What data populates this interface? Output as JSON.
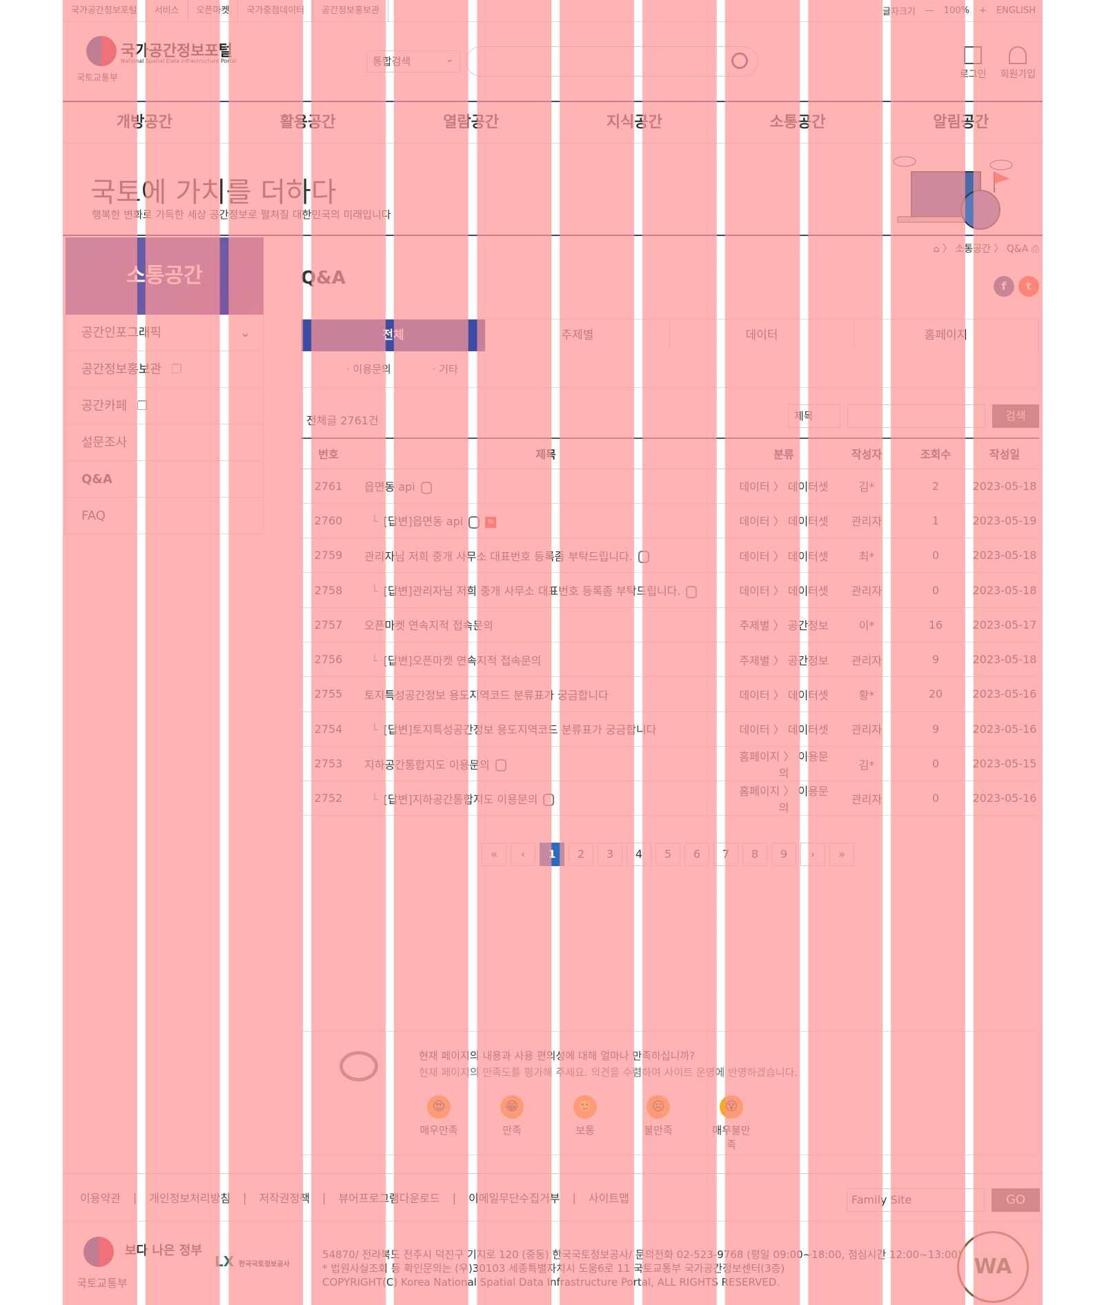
{
  "util": {
    "left": [
      "국가공간정보포털",
      "서비스",
      "오픈마켓",
      "국가중점데이터",
      "공간정보홍보관"
    ],
    "font_label": "글자크기",
    "minus": "—",
    "zoom": "100%",
    "plus": "+",
    "lang": "ENGLISH"
  },
  "header": {
    "title": "국가공간정보포털",
    "subtitle": "National Spatial Data Infrastructure Portal",
    "ministry": "국토교통부",
    "search_select": "통합검색",
    "login": "로그인",
    "join": "회원가입"
  },
  "gnb": [
    "개방공간",
    "활용공간",
    "열람공간",
    "지식공간",
    "소통공간",
    "알림공간"
  ],
  "banner": {
    "headline": "국토에 가치를 더하다",
    "sub": "행복한 변화로 가득한 세상 공간정보로 펼쳐질 대한민국의 미래입니다"
  },
  "side": {
    "head": "소통공간",
    "items": [
      "공간인포그래픽",
      "공간정보홍보관",
      "공간카페",
      "설문조사",
      "Q&A",
      "FAQ"
    ]
  },
  "crumb": {
    "parent": "소통공간",
    "current": "Q&A"
  },
  "page": {
    "title": "Q&A"
  },
  "tabs": {
    "items": [
      "전체",
      "주제별",
      "데이터",
      "홈페이지"
    ],
    "subs": [
      "· 이용문의",
      "· 기타"
    ]
  },
  "list": {
    "total": "전체글 2761건",
    "search_field": "제목",
    "search_btn": "검색",
    "headers": [
      "번호",
      "제목",
      "분류",
      "작성자",
      "조회수",
      "작성일"
    ],
    "rows": [
      {
        "no": "2761",
        "title": "읍면동 api",
        "cat": "데이터 〉 데이터셋",
        "author": "김*",
        "views": "2",
        "date": "2023-05-18",
        "reply": false,
        "lock": true,
        "new": false
      },
      {
        "no": "2760",
        "title": "[답변]읍면동 api",
        "cat": "데이터 〉 데이터셋",
        "author": "관리자",
        "views": "1",
        "date": "2023-05-19",
        "reply": true,
        "lock": true,
        "new": true
      },
      {
        "no": "2759",
        "title": "관리자님 저희 중개 사무소 대표번호 등록좀 부탁드립니다.",
        "cat": "데이터 〉 데이터셋",
        "author": "최*",
        "views": "0",
        "date": "2023-05-18",
        "reply": false,
        "lock": true,
        "new": false
      },
      {
        "no": "2758",
        "title": "[답변]관리자님 저희 중개 사무소 대표번호 등록좀 부탁드립니다.",
        "cat": "데이터 〉 데이터셋",
        "author": "관리자",
        "views": "0",
        "date": "2023-05-18",
        "reply": true,
        "lock": true,
        "new": false
      },
      {
        "no": "2757",
        "title": "오픈마켓 연속지적 접속문의",
        "cat": "주제별 〉 공간정보",
        "author": "이*",
        "views": "16",
        "date": "2023-05-17",
        "reply": false,
        "lock": false,
        "new": false
      },
      {
        "no": "2756",
        "title": "[답변]오픈마켓 연속지적 접속문의",
        "cat": "주제별 〉 공간정보",
        "author": "관리자",
        "views": "9",
        "date": "2023-05-18",
        "reply": true,
        "lock": false,
        "new": false
      },
      {
        "no": "2755",
        "title": "토지특성공간정보 용도지역코드 분류표가 궁금합니다",
        "cat": "데이터 〉 데이터셋",
        "author": "황*",
        "views": "20",
        "date": "2023-05-16",
        "reply": false,
        "lock": false,
        "new": false
      },
      {
        "no": "2754",
        "title": "[답변]토지특성공간정보 용도지역코드 분류표가 궁금합니다",
        "cat": "데이터 〉 데이터셋",
        "author": "관리자",
        "views": "9",
        "date": "2023-05-16",
        "reply": true,
        "lock": false,
        "new": false
      },
      {
        "no": "2753",
        "title": "지하공간통합지도 이용문의",
        "cat": "홈페이지 〉 이용문의",
        "author": "김*",
        "views": "0",
        "date": "2023-05-15",
        "reply": false,
        "lock": true,
        "new": false
      },
      {
        "no": "2752",
        "title": "[답변]지하공간통합지도 이용문의",
        "cat": "홈페이지 〉 이용문의",
        "author": "관리자",
        "views": "0",
        "date": "2023-05-16",
        "reply": true,
        "lock": true,
        "new": false
      }
    ]
  },
  "pager": [
    "«",
    "‹",
    "1",
    "2",
    "3",
    "4",
    "5",
    "6",
    "7",
    "8",
    "9",
    "›",
    "»"
  ],
  "survey": {
    "q1": "현재 페이지의 내용과 사용 편의성에 대해 얼마나 만족하십니까?",
    "q2": "현재 페이지의 만족도를 평가해 주세요. 의견을 수렴하여 사이트 운영에 반영하겠습니다.",
    "options": [
      "매우만족",
      "만족",
      "보통",
      "불만족",
      "매우불만족"
    ]
  },
  "footer": {
    "links": [
      "이용약관",
      "|",
      "개인정보처리방침",
      "|",
      "저작권정책",
      "|",
      "뷰어프로그램다운로드",
      "|",
      "이메일무단수집거부",
      "|",
      "사이트맵"
    ],
    "family": "Family Site",
    "go": "GO",
    "ministry": "국토교통부",
    "better": "보다 나은 정부",
    "lx": "LX",
    "lx_name": "한국국토정보공사",
    "info1": "54870/ 전라북도 전주시 덕진구 기지로 120 (중동) 한국국토정보공사/ 문의전화 02-523-9768 (평일 09:00~18:00, 점심시간 12:00~13:00)",
    "info2": "* 법원사실조회 등 확인문의는 (우)30103 세종특별자치시 도움6로 11 국토교통부 국가공간정보센터(3층)",
    "info3": "COPYRIGHT(C) Korea National Spatial Data Infrastructure Portal, ALL RIGHTS RESERVED.",
    "wa": "WA"
  }
}
